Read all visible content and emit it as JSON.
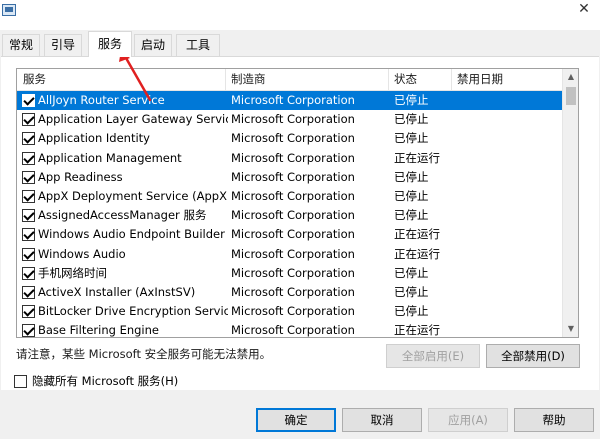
{
  "window": {
    "close_glyph": "✕"
  },
  "tabs": [
    {
      "label": "常规"
    },
    {
      "label": "引导"
    },
    {
      "label": "服务"
    },
    {
      "label": "启动"
    },
    {
      "label": "工具"
    }
  ],
  "table": {
    "columns": [
      "服务",
      "制造商",
      "状态",
      "禁用日期"
    ],
    "rows": [
      {
        "name": "AllJoyn Router Service",
        "maker": "Microsoft Corporation",
        "status": "已停止",
        "date": ""
      },
      {
        "name": "Application Layer Gateway Service",
        "maker": "Microsoft Corporation",
        "status": "已停止",
        "date": ""
      },
      {
        "name": "Application Identity",
        "maker": "Microsoft Corporation",
        "status": "已停止",
        "date": ""
      },
      {
        "name": "Application Management",
        "maker": "Microsoft Corporation",
        "status": "正在运行",
        "date": ""
      },
      {
        "name": "App Readiness",
        "maker": "Microsoft Corporation",
        "status": "已停止",
        "date": ""
      },
      {
        "name": "AppX Deployment Service (AppX...",
        "maker": "Microsoft Corporation",
        "status": "已停止",
        "date": ""
      },
      {
        "name": "AssignedAccessManager 服务",
        "maker": "Microsoft Corporation",
        "status": "已停止",
        "date": ""
      },
      {
        "name": "Windows Audio Endpoint Builder",
        "maker": "Microsoft Corporation",
        "status": "正在运行",
        "date": ""
      },
      {
        "name": "Windows Audio",
        "maker": "Microsoft Corporation",
        "status": "正在运行",
        "date": ""
      },
      {
        "name": "手机网络时间",
        "maker": "Microsoft Corporation",
        "status": "已停止",
        "date": ""
      },
      {
        "name": "ActiveX Installer (AxInstSV)",
        "maker": "Microsoft Corporation",
        "status": "已停止",
        "date": ""
      },
      {
        "name": "BitLocker Drive Encryption Service",
        "maker": "Microsoft Corporation",
        "status": "已停止",
        "date": ""
      },
      {
        "name": "Base Filtering Engine",
        "maker": "Microsoft Corporation",
        "status": "正在运行",
        "date": ""
      }
    ]
  },
  "scroll": {
    "up_glyph": "▲",
    "down_glyph": "▼"
  },
  "notice": "请注意，某些 Microsoft 安全服务可能无法禁用。",
  "buttons": {
    "enable_all": "全部启用(E)",
    "disable_all": "全部禁用(D)",
    "ok": "确定",
    "cancel": "取消",
    "apply": "应用(A)",
    "help": "帮助"
  },
  "hide_ms_label": "隐藏所有 Microsoft 服务(H)",
  "colors": {
    "selection": "#0078d7",
    "annotation_arrow": "#e02020"
  }
}
